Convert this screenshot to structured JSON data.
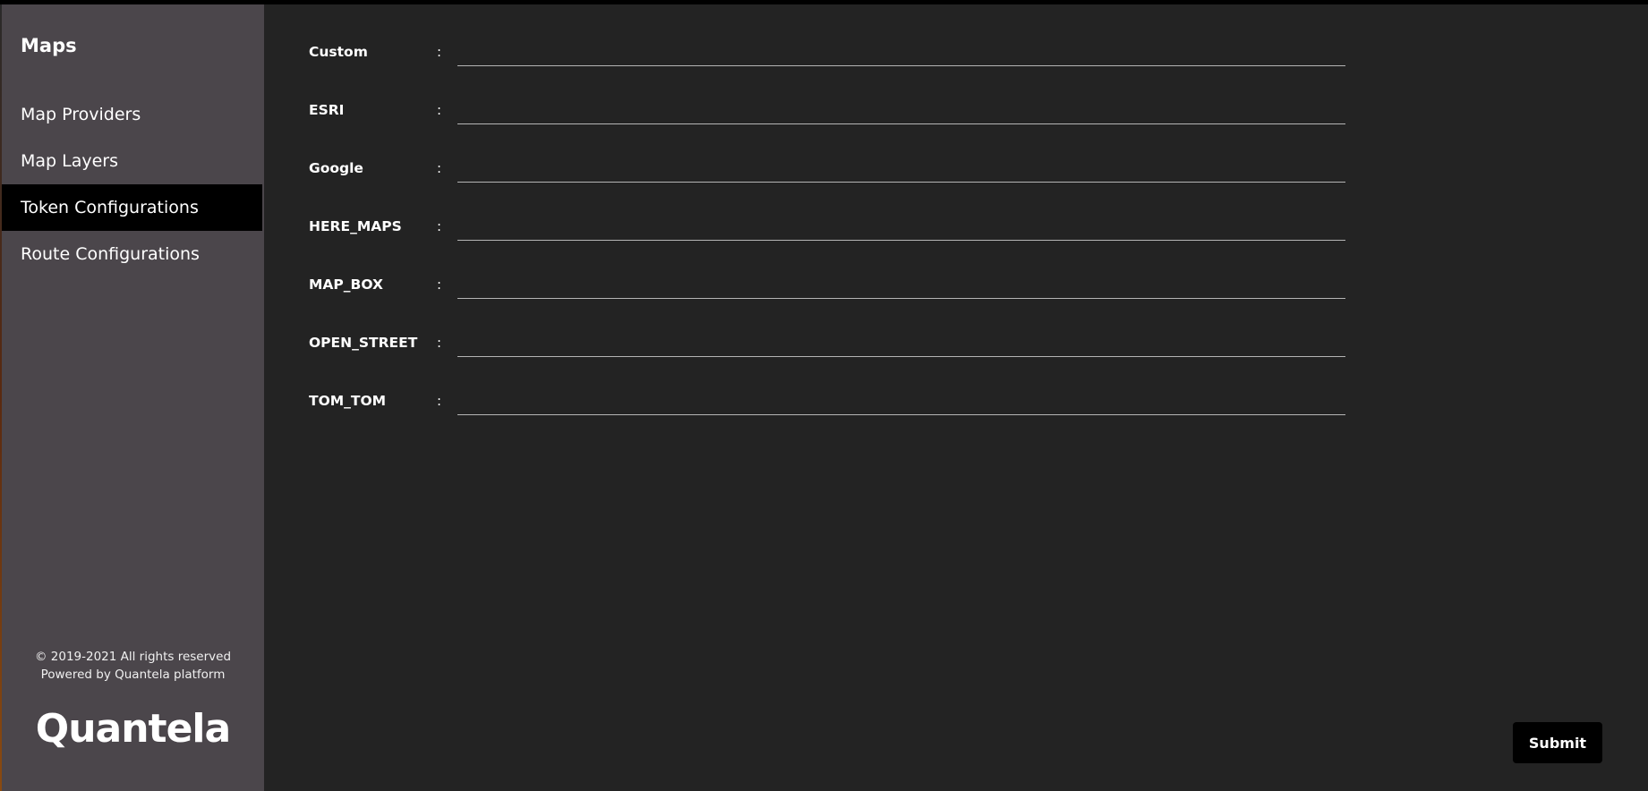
{
  "sidebar": {
    "title": "Maps",
    "items": [
      {
        "label": "Map Providers",
        "active": false
      },
      {
        "label": "Map Layers",
        "active": false
      },
      {
        "label": "Token Configurations",
        "active": true
      },
      {
        "label": "Route Configurations",
        "active": false
      }
    ],
    "footer": {
      "copyright": "© 2019-2021 All rights reserved",
      "powered": "Powered by Quantela platform"
    },
    "logo": "Quantela"
  },
  "form": {
    "separator": ":",
    "rows": [
      {
        "label": "Custom",
        "value": ""
      },
      {
        "label": "ESRI",
        "value": ""
      },
      {
        "label": "Google",
        "value": ""
      },
      {
        "label": "HERE_MAPS",
        "value": ""
      },
      {
        "label": "MAP_BOX",
        "value": ""
      },
      {
        "label": "OPEN_STREET",
        "value": ""
      },
      {
        "label": "TOM_TOM",
        "value": ""
      }
    ],
    "submit_label": "Submit"
  },
  "colors": {
    "sidebar_bg": "#4b464b",
    "main_bg": "#232323",
    "active_item_bg": "#000000",
    "button_bg": "#000000"
  }
}
